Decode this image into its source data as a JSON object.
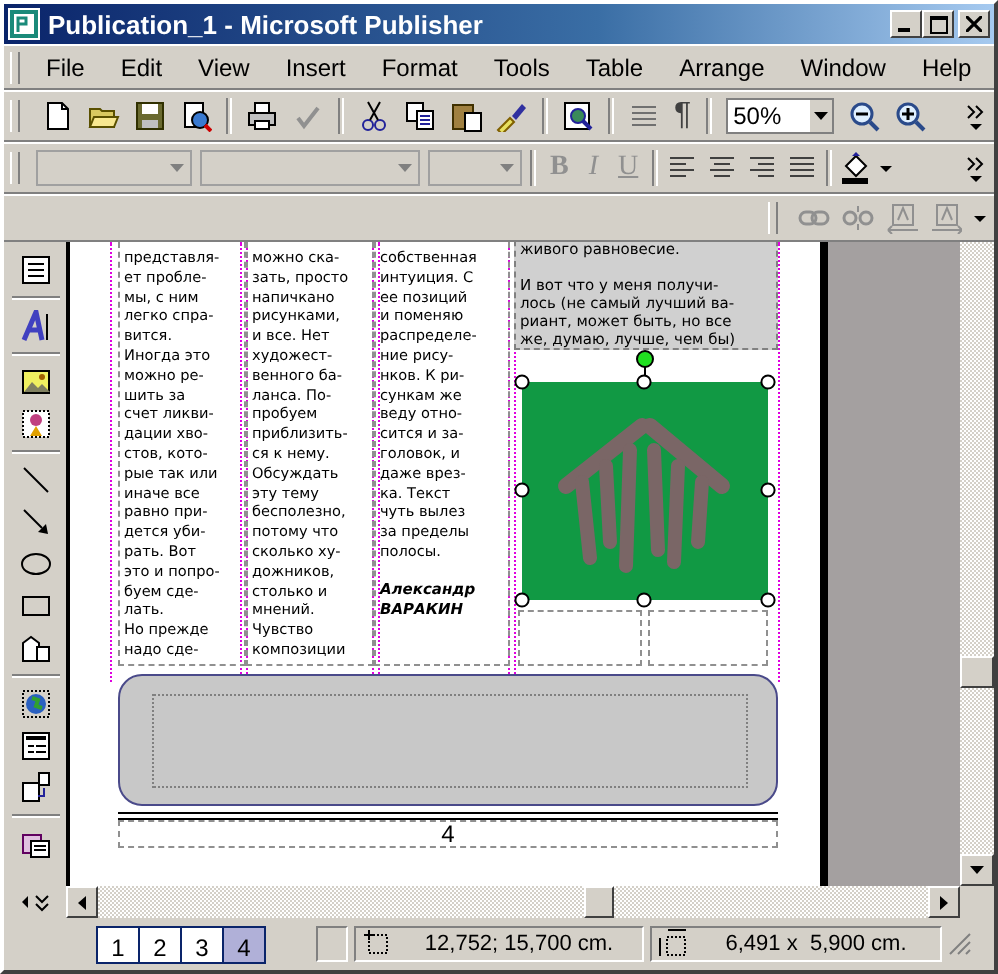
{
  "window": {
    "title": "Publication_1 - Microsoft Publisher"
  },
  "menu": [
    {
      "label": "File"
    },
    {
      "label": "Edit"
    },
    {
      "label": "View"
    },
    {
      "label": "Insert"
    },
    {
      "label": "Format"
    },
    {
      "label": "Tools"
    },
    {
      "label": "Table"
    },
    {
      "label": "Arrange"
    },
    {
      "label": "Window"
    },
    {
      "label": "Help"
    }
  ],
  "standard_toolbar": {
    "pilcrow": "¶",
    "zoom": {
      "value": "50%"
    }
  },
  "formatting_toolbar": {
    "style_buttons": [
      {
        "label": "B",
        "disabled": true
      },
      {
        "label": "I",
        "disabled": true
      },
      {
        "label": "U",
        "disabled": true
      }
    ]
  },
  "page": {
    "columns": [
      {
        "text": "представля-\nет пробле-\nмы, с ним\nлегко спра-\nвится.\nИногда это\nможно ре-\nшить за\nсчет ликви-\nдации хво-\nстов, кото-\nрые так или\nиначе все\nравно при-\nдется уби-\nрать. Вот\nэто и попро-\nбуем сде-\nлать.\nНо прежде\nнадо сде-"
      },
      {
        "text": "можно ска-\nзать, просто\nнапичкано\nрисунками,\nи все. Нет\nхудожест-\nвенного ба-\nланса. По-\nпробуем\nприблизить-\nся к нему.\nОбсуждать\nэту тему\nбесполезно,\nпотому что\nсколько ху-\nдожников,\nстолько и\nмнений.\nЧувство\nкомпозиции"
      },
      {
        "text": "собственная\nинтуиция. С\nее позиций\nи поменяю\nраспределе-\nние рису-\nнков. К ри-\nсункам же\nведу отно-\nсится и за-\nголовок, и\nдаже врез-\nка. Текст\nчуть вылез\nза пределы\nполосы."
      }
    ],
    "signature": "Александр\nВАРАКИН",
    "text_box": {
      "text": "живого равновесие.\n\nИ вот что у меня получи-\nлось (не самый лучший ва-\nриант, может быть, но все\nже, думаю, лучше, чем бы)"
    },
    "page_number": "4"
  },
  "page_tabs": [
    {
      "label": "1",
      "selected": false
    },
    {
      "label": "2",
      "selected": false
    },
    {
      "label": "3",
      "selected": false
    },
    {
      "label": "4",
      "selected": true
    }
  ],
  "status_bar": {
    "position": "12,752; 15,700 cm.",
    "size": "6,491 x  5,900 cm."
  }
}
